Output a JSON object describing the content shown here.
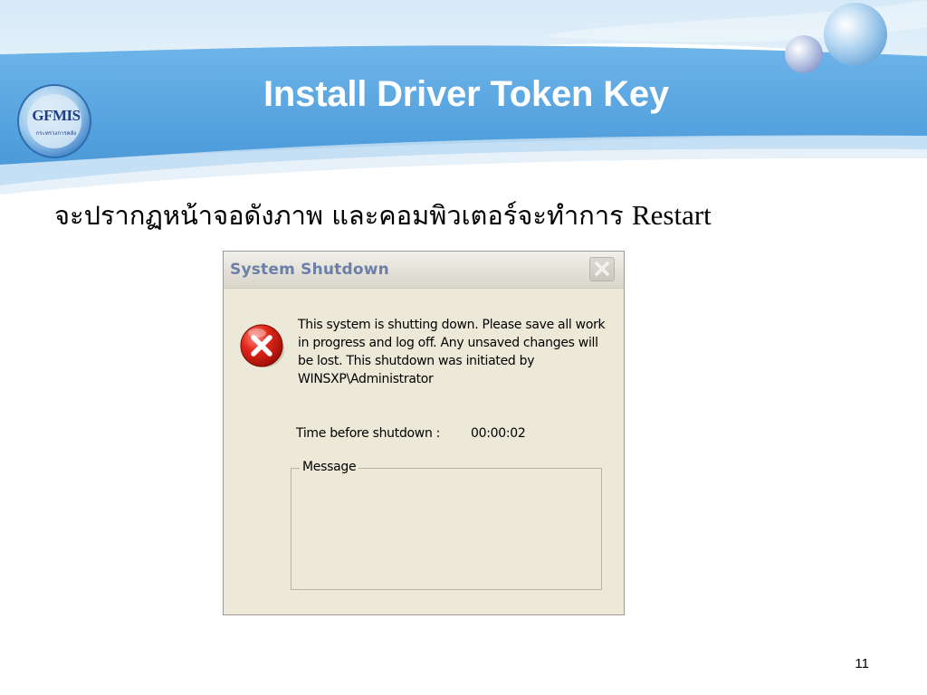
{
  "slide": {
    "title": "Install Driver Token Key",
    "subtitle_thai": "จะปรากฏหน้าจอดังภาพ และคอมพิวเตอร์จะทำการ",
    "subtitle_latin": "Restart",
    "page_number": "11",
    "logo": {
      "text": "GFMIS",
      "subtext": "กระทรวงการคลัง"
    },
    "colors": {
      "header_blue": "#5aa6e3",
      "title_text": "#ffffff"
    }
  },
  "dialog": {
    "title": "System Shutdown",
    "icon": "error-icon",
    "message": "This system is shutting down. Please save all work in progress and log off. Any unsaved changes will be lost. This shutdown was initiated by WINSXP\\Administrator",
    "time_label": "Time before shutdown :",
    "time_value": "00:00:02",
    "message_group_label": "Message",
    "message_content": ""
  }
}
